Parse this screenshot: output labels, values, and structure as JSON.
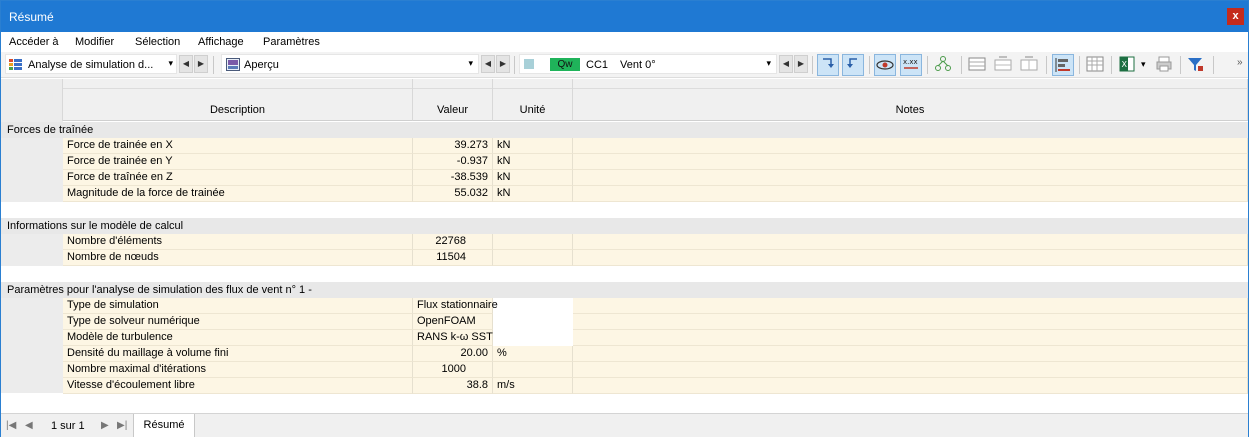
{
  "window": {
    "title": "Résumé",
    "close_label": "x"
  },
  "menu": [
    "Accéder à",
    "Modifier",
    "Sélection",
    "Affichage",
    "Paramètres"
  ],
  "toolbar": {
    "analysis_combo": "Analyse de simulation d...",
    "view_combo": "Aperçu",
    "load_badge": "Qw",
    "load_case": "CC1",
    "load_name": "Vent 0°"
  },
  "table": {
    "headers": {
      "description": "Description",
      "value": "Valeur",
      "unit": "Unité",
      "notes": "Notes"
    },
    "sections": [
      {
        "title": "Forces de traînée",
        "rows": [
          {
            "description": "Force de trainée en X",
            "value": "39.273",
            "unit": "kN"
          },
          {
            "description": "Force de trainée en Y",
            "value": "-0.937",
            "unit": "kN"
          },
          {
            "description": "Force de traînée en Z",
            "value": "-38.539",
            "unit": "kN"
          },
          {
            "description": "Magnitude de la force de trainée",
            "value": "55.032",
            "unit": "kN"
          }
        ]
      },
      {
        "title": "Informations sur le modèle de calcul",
        "rows": [
          {
            "description": "Nombre d'éléments",
            "value": "22768",
            "unit": ""
          },
          {
            "description": "Nombre de nœuds",
            "value": "11504",
            "unit": ""
          }
        ]
      },
      {
        "title": "Paramètres pour l'analyse de simulation des flux de vent n° 1 -",
        "rows": [
          {
            "description": "Type de simulation",
            "value": "Flux stationnaire",
            "unit": "",
            "text": true
          },
          {
            "description": "Type de solveur numérique",
            "value": "OpenFOAM",
            "unit": "",
            "text": true
          },
          {
            "description": "Modèle de turbulence",
            "value": "RANS k-ω SST",
            "unit": "",
            "text": true
          },
          {
            "description": "Densité du maillage à volume fini",
            "value": "20.00",
            "unit": "%"
          },
          {
            "description": "Nombre maximal d'itérations",
            "value": "1000",
            "unit": ""
          },
          {
            "description": "Vitesse d'écoulement libre",
            "value": "38.8",
            "unit": "m/s"
          }
        ]
      }
    ]
  },
  "status": {
    "page": "1 sur 1",
    "sheet_tab": "Résumé"
  },
  "colors": {
    "titlebar": "#1f79d3",
    "row_bg": "#fdf6e4",
    "section_bg": "#e8e8e8",
    "badge_green": "#1fb35a"
  }
}
